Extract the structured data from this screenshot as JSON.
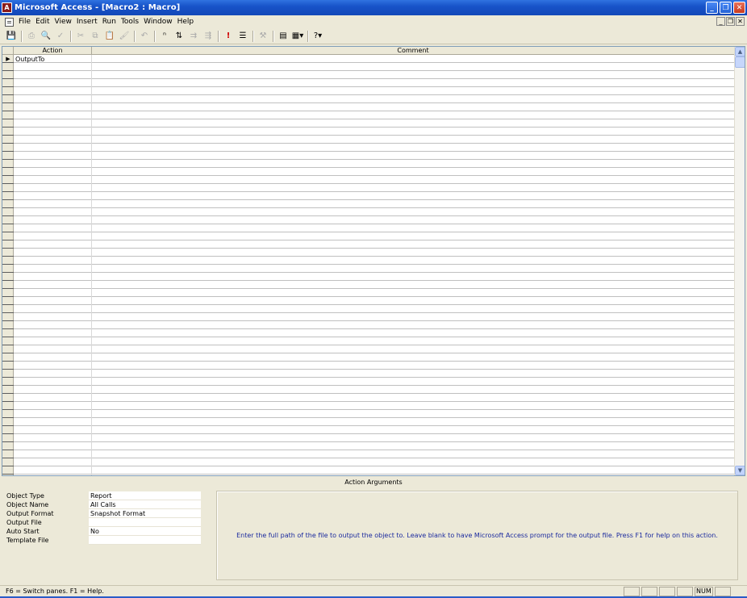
{
  "window": {
    "title": "Microsoft Access - [Macro2 : Macro]",
    "app_icon_letter": "A",
    "controls": [
      "_",
      "❐",
      "✕"
    ]
  },
  "menubar": {
    "items": [
      "File",
      "Edit",
      "View",
      "Insert",
      "Run",
      "Tools",
      "Window",
      "Help"
    ],
    "mdi_controls": [
      "_",
      "❐",
      "✕"
    ]
  },
  "toolbar": {
    "icons": [
      "save-icon",
      "print-icon",
      "print-preview-icon",
      "spelling-icon",
      "cut-icon",
      "copy-icon",
      "paste-icon",
      "format-painter-icon",
      "undo-icon",
      "macro-names-icon",
      "conditions-icon",
      "insert-rows-icon",
      "delete-rows-icon",
      "run-icon",
      "single-step-icon",
      "build-icon",
      "properties-icon",
      "new-object-icon",
      "help-icon"
    ]
  },
  "grid": {
    "columns": [
      "Action",
      "Comment"
    ],
    "rows": [
      {
        "action": "OutputTo",
        "comment": ""
      }
    ],
    "current_row_marker": "▶"
  },
  "action_arguments": {
    "title": "Action Arguments",
    "fields": [
      {
        "label": "Object Type",
        "value": "Report"
      },
      {
        "label": "Object Name",
        "value": "All Calls"
      },
      {
        "label": "Output Format",
        "value": "Snapshot Format"
      },
      {
        "label": "Output File",
        "value": ""
      },
      {
        "label": "Auto Start",
        "value": "No"
      },
      {
        "label": "Template File",
        "value": ""
      }
    ],
    "help_text": "Enter the full path of the file to output the object to. Leave blank to have Microsoft Access prompt for the output file. Press F1 for help on this action."
  },
  "statusbar": {
    "text": "F6 = Switch panes.  F1 = Help.",
    "num_indicator": "NUM"
  }
}
